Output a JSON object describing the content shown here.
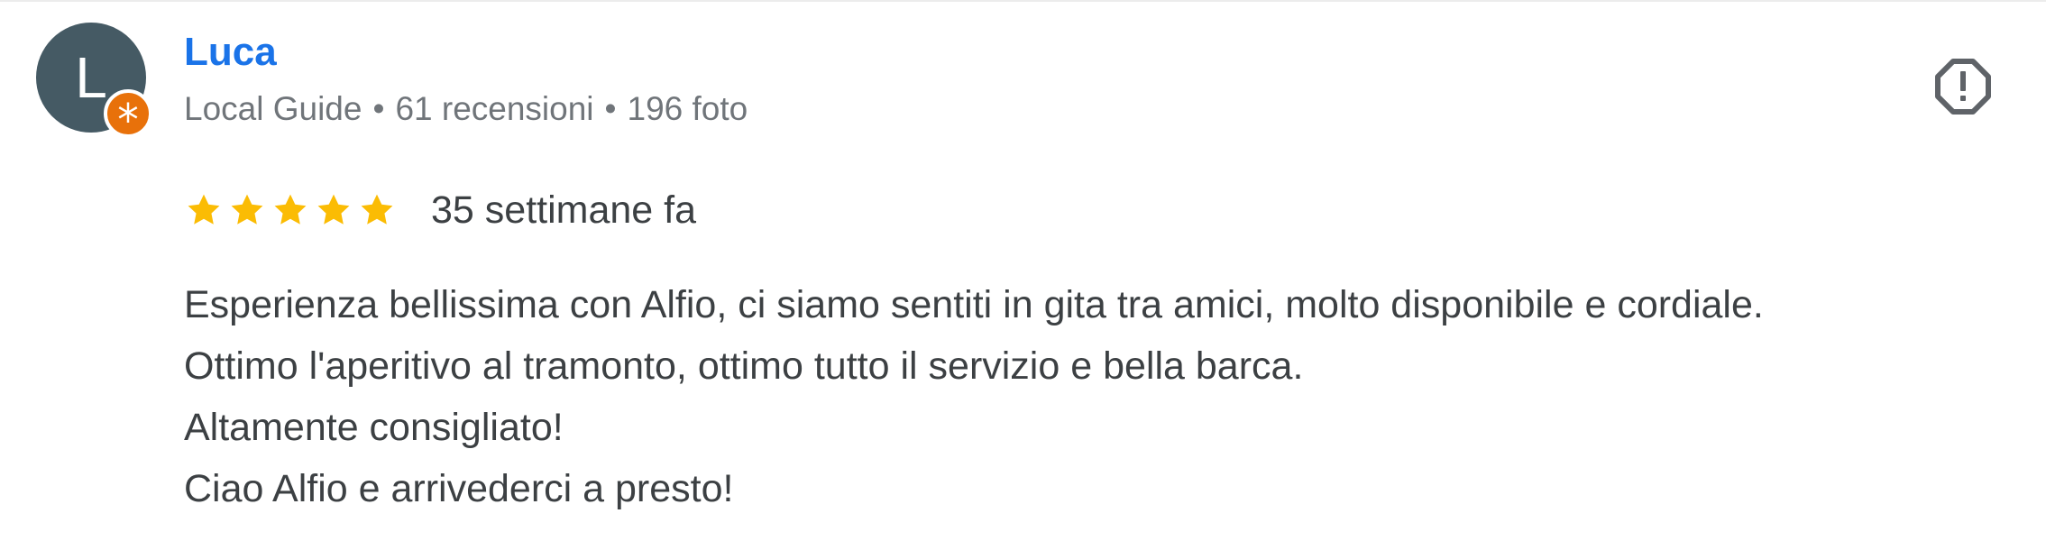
{
  "author": {
    "avatar_letter": "L",
    "name": "Luca",
    "badge": "Local Guide",
    "reviews_count": "61 recensioni",
    "photos_count": "196 foto",
    "separator": "•"
  },
  "rating": {
    "stars": 5,
    "time_ago": "35 settimane fa"
  },
  "review": {
    "lines": [
      "Esperienza bellissima con Alfio, ci siamo sentiti in gita tra amici, molto disponibile e cordiale.",
      "Ottimo l'aperitivo al tramonto, ottimo tutto il servizio e bella barca.",
      "Altamente consigliato!",
      "Ciao Alfio e arrivederci a presto!"
    ]
  },
  "icons": {
    "report": "report-flag-icon",
    "guide_badge": "local-guide-star-icon",
    "star": "star-icon"
  },
  "colors": {
    "name": "#1a73e8",
    "avatar_bg": "#455a64",
    "badge_bg": "#e8710a",
    "star": "#fbbc04",
    "meta_text": "#70757a",
    "body_text": "#3c4043"
  }
}
